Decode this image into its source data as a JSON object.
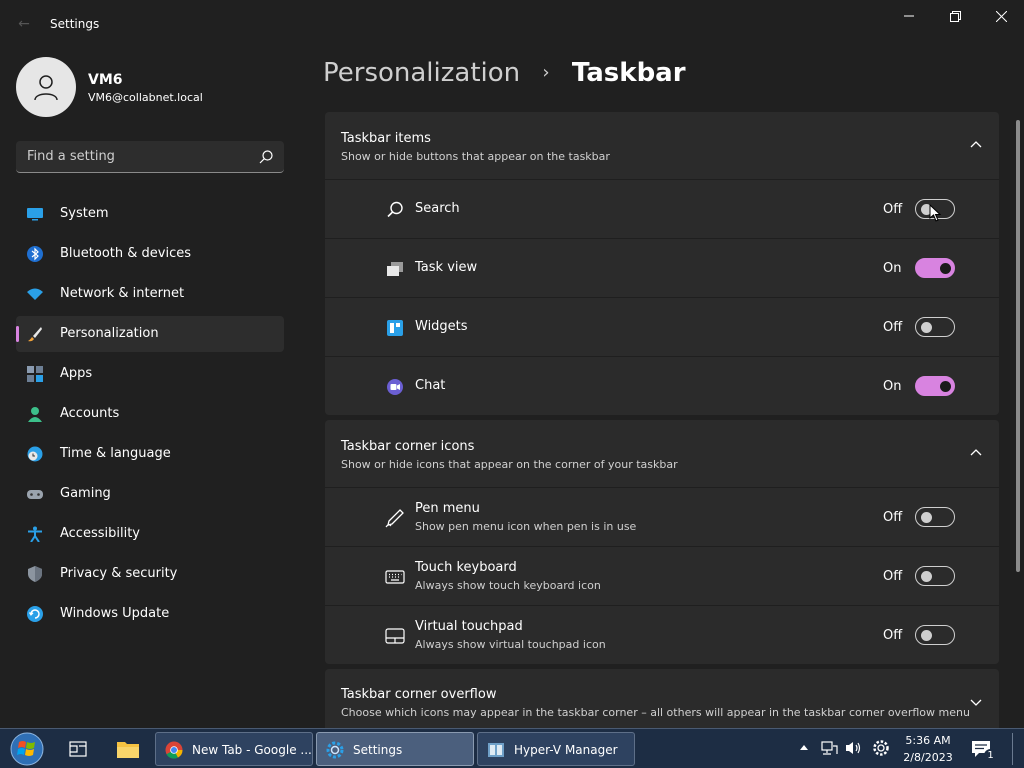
{
  "window": {
    "title": "Settings"
  },
  "user": {
    "name": "VM6",
    "email": "VM6@collabnet.local"
  },
  "search": {
    "placeholder": "Find a setting"
  },
  "nav": [
    {
      "label": "System",
      "icon": "monitor-icon"
    },
    {
      "label": "Bluetooth & devices",
      "icon": "bluetooth-icon"
    },
    {
      "label": "Network & internet",
      "icon": "wifi-icon"
    },
    {
      "label": "Personalization",
      "icon": "brush-icon",
      "active": true
    },
    {
      "label": "Apps",
      "icon": "apps-icon"
    },
    {
      "label": "Accounts",
      "icon": "person-icon"
    },
    {
      "label": "Time & language",
      "icon": "clock-globe-icon"
    },
    {
      "label": "Gaming",
      "icon": "gamepad-icon"
    },
    {
      "label": "Accessibility",
      "icon": "accessibility-icon"
    },
    {
      "label": "Privacy & security",
      "icon": "shield-icon"
    },
    {
      "label": "Windows Update",
      "icon": "update-icon"
    }
  ],
  "breadcrumb": {
    "parent": "Personalization",
    "separator": "›",
    "current": "Taskbar"
  },
  "taskbar_items": {
    "title": "Taskbar items",
    "subtitle": "Show or hide buttons that appear on the taskbar",
    "rows": [
      {
        "label": "Search",
        "state": "Off",
        "on": false
      },
      {
        "label": "Task view",
        "state": "On",
        "on": true
      },
      {
        "label": "Widgets",
        "state": "Off",
        "on": false
      },
      {
        "label": "Chat",
        "state": "On",
        "on": true
      }
    ]
  },
  "corner_icons": {
    "title": "Taskbar corner icons",
    "subtitle": "Show or hide icons that appear on the corner of your taskbar",
    "rows": [
      {
        "label": "Pen menu",
        "desc": "Show pen menu icon when pen is in use",
        "state": "Off",
        "on": false
      },
      {
        "label": "Touch keyboard",
        "desc": "Always show touch keyboard icon",
        "state": "Off",
        "on": false
      },
      {
        "label": "Virtual touchpad",
        "desc": "Always show virtual touchpad icon",
        "state": "Off",
        "on": false
      }
    ]
  },
  "corner_overflow": {
    "title": "Taskbar corner overflow",
    "subtitle": "Choose which icons may appear in the taskbar corner – all others will appear in the taskbar corner overflow menu"
  },
  "os_taskbar": {
    "apps": [
      {
        "label": "New Tab - Google ..."
      },
      {
        "label": "Settings"
      },
      {
        "label": "Hyper-V Manager"
      }
    ],
    "time": "5:36 AM",
    "date": "2/8/2023",
    "notification_count": "1"
  },
  "colors": {
    "accent": "#d883e0",
    "background": "#202020",
    "card": "#2b2b2b",
    "taskbar": "#1d2d44"
  }
}
